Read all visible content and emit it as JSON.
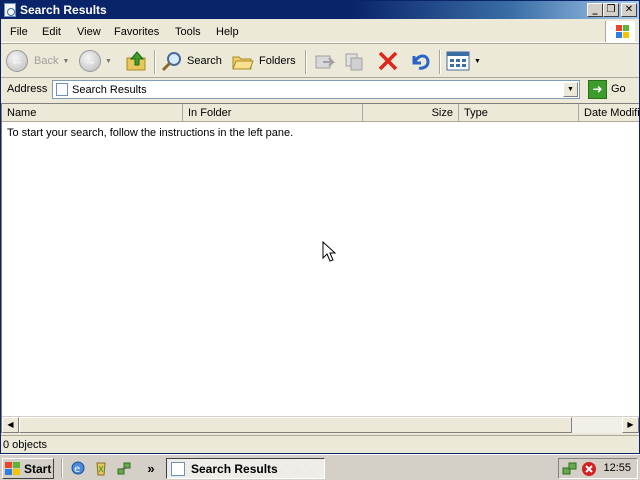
{
  "window": {
    "title": "Search Results"
  },
  "titlebar_buttons": {
    "minimize": "_",
    "restore": "❐",
    "close": "✕"
  },
  "menu": {
    "items": [
      "File",
      "Edit",
      "View",
      "Favorites",
      "Tools",
      "Help"
    ]
  },
  "toolbar": {
    "back_label": "Back",
    "search_label": "Search",
    "folders_label": "Folders"
  },
  "address": {
    "label": "Address",
    "value": "Search Results",
    "go_label": "Go"
  },
  "list": {
    "columns": [
      "Name",
      "In Folder",
      "Size",
      "Type",
      "Date Modifi"
    ],
    "empty_message": "To start your search, follow the instructions in the left pane."
  },
  "status": {
    "text": "0 objects"
  },
  "taskbar": {
    "start_label": "Start",
    "chevron": "»",
    "task_label": "Search Results",
    "clock": "12:55"
  },
  "colors": {
    "titlebar_start": "#0a246a",
    "titlebar_end": "#a6caf0",
    "face": "#ece9d8",
    "delete_red": "#e0241c",
    "undo_blue": "#2a64c8",
    "go_green": "#3c9c2c"
  },
  "icons": [
    "app-icon",
    "windows-logo-icon",
    "back-arrow-icon",
    "forward-arrow-icon",
    "up-folder-icon",
    "search-magnifier-icon",
    "folders-icon",
    "move-to-icon",
    "copy-to-icon",
    "delete-icon",
    "undo-icon",
    "views-icon",
    "page-icon",
    "go-arrow-icon",
    "mouse-cursor-icon",
    "windows-flag-icon",
    "ie-icon",
    "recycle-icon",
    "network-icon",
    "search-window-icon",
    "network-tray-icon",
    "error-tray-icon"
  ]
}
